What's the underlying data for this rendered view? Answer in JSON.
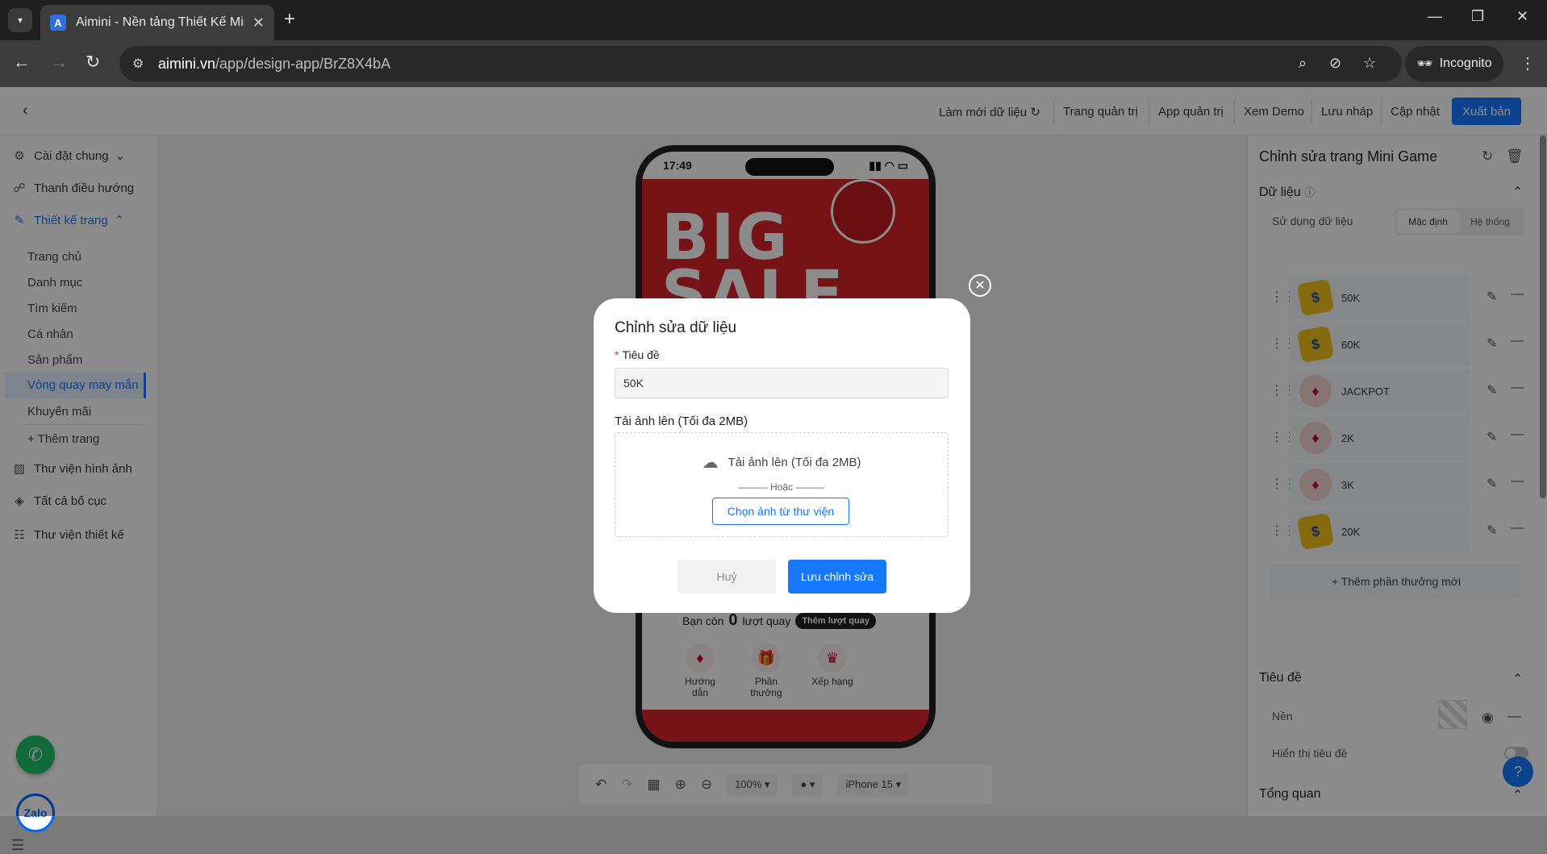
{
  "browser": {
    "tab_title": "Aimini - Nền tảng Thiết Kế Mini",
    "favicon_letter": "A",
    "url_host": "aimini.vn",
    "url_path": "/app/design-app/BrZ8X4bA",
    "incognito_label": "Incognito"
  },
  "topbar": {
    "refresh_data": "Làm mới dữ liệu",
    "admin_page": "Trang quản trị",
    "admin_app": "App quản trị",
    "view_demo": "Xem Demo",
    "save_draft": "Lưu nháp",
    "update": "Cập nhật",
    "publish": "Xuất bản"
  },
  "sidebar": {
    "general_settings": "Cài đặt chung",
    "nav_bar": "Thanh điều hướng",
    "page_design": "Thiết kế trang",
    "pages": [
      "Trang chủ",
      "Danh mục",
      "Tìm kiếm",
      "Cá nhân",
      "Sản phẩm",
      "Vòng quay may mắn",
      "Khuyến mãi"
    ],
    "add_page": "+ Thêm trang",
    "image_library": "Thư viện hình ảnh",
    "all_layouts": "Tất cả bố cục",
    "design_library": "Thư viện thiết kế",
    "zalo": "Zalo"
  },
  "phone": {
    "time": "17:49",
    "banner_line1": "BIG",
    "banner_line2": "SALE",
    "turns_prefix": "Bạn còn",
    "turns_count": "0",
    "turns_suffix": "lượt quay",
    "add_turns": "Thêm lượt quay",
    "menu": [
      "Hướng dẫn",
      "Phần thưởng",
      "Xếp hạng"
    ]
  },
  "bottom_toolbar": {
    "zoom": "100%",
    "device": "iPhone 15"
  },
  "right_panel": {
    "title": "Chỉnh sửa trang Mini Game",
    "data_section": "Dữ liệu",
    "use_data_label": "Sử dụng dữ liệu",
    "seg_default": "Mặc định",
    "seg_system": "Hệ thống",
    "rewards": [
      {
        "name": "50K",
        "icon": "tag-icon"
      },
      {
        "name": "60K",
        "icon": "tag-icon"
      },
      {
        "name": "JACKPOT",
        "icon": "gift-icon"
      },
      {
        "name": "2K",
        "icon": "gift-icon"
      },
      {
        "name": "3K",
        "icon": "gift-icon"
      },
      {
        "name": "20K",
        "icon": "tag-icon"
      }
    ],
    "add_reward": "+ Thêm phần thưởng mới",
    "title_section": "Tiêu đề",
    "background_label": "Nền",
    "show_title_label": "Hiển thị tiêu đề",
    "overview_section": "Tổng quan"
  },
  "modal": {
    "title": "Chỉnh sửa dữ liệu",
    "field_label": "Tiêu đề",
    "field_value": "50K",
    "upload_label": "Tải ảnh lên (Tối đa 2MB)",
    "upload_text": "Tải ảnh lên (Tối đa 2MB)",
    "or_text": "——— Hoặc ———",
    "choose_library": "Chọn ảnh từ thư viện",
    "cancel": "Huỷ",
    "save": "Lưu chỉnh sửa"
  },
  "colors": {
    "accent": "#1677ff",
    "banner_red": "#d8232a"
  }
}
